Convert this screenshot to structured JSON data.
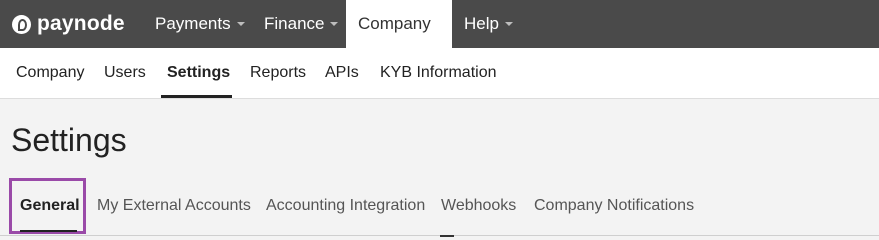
{
  "brand": {
    "name": "paynode"
  },
  "topnav": {
    "items": [
      {
        "label": "Payments"
      },
      {
        "label": "Finance"
      },
      {
        "label": "Company"
      },
      {
        "label": "Help"
      }
    ]
  },
  "subnav": {
    "items": [
      {
        "label": "Company"
      },
      {
        "label": "Users"
      },
      {
        "label": "Settings"
      },
      {
        "label": "Reports"
      },
      {
        "label": "APIs"
      },
      {
        "label": "KYB Information"
      }
    ],
    "active": "Settings"
  },
  "page": {
    "title": "Settings"
  },
  "tabs": {
    "items": [
      {
        "label": "General"
      },
      {
        "label": "My External Accounts"
      },
      {
        "label": "Accounting Integration"
      },
      {
        "label": "Webhooks"
      },
      {
        "label": "Company Notifications"
      }
    ],
    "active": "General",
    "highlight_color": "#9a4aa8"
  },
  "colors": {
    "topbar": "#4a4a4a",
    "page_bg": "#f3f3f3"
  }
}
